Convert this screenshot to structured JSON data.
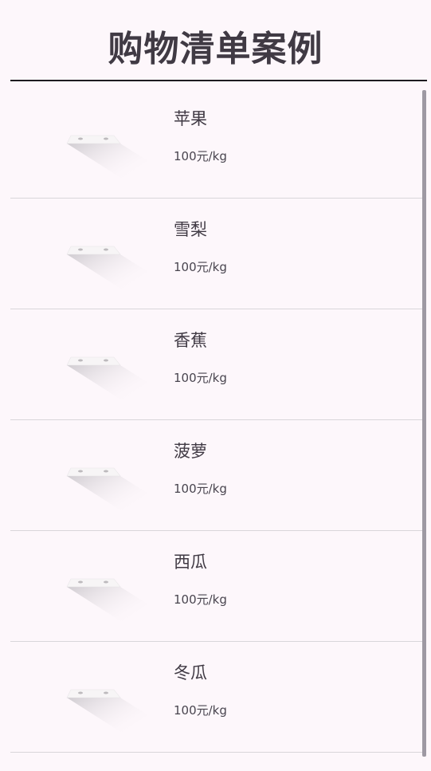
{
  "header": {
    "title": "购物清单案例"
  },
  "items": [
    {
      "name": "苹果",
      "price": "100元/kg",
      "image_icon": "placeholder-image-icon"
    },
    {
      "name": "雪梨",
      "price": "100元/kg",
      "image_icon": "placeholder-image-icon"
    },
    {
      "name": "香蕉",
      "price": "100元/kg",
      "image_icon": "placeholder-image-icon"
    },
    {
      "name": "菠萝",
      "price": "100元/kg",
      "image_icon": "placeholder-image-icon"
    },
    {
      "name": "西瓜",
      "price": "100元/kg",
      "image_icon": "placeholder-image-icon"
    },
    {
      "name": "冬瓜",
      "price": "100元/kg",
      "image_icon": "placeholder-image-icon"
    }
  ],
  "colors": {
    "background": "#FDF7FB",
    "title_text": "#403A44",
    "divider": "#D9D6DA",
    "scrollbar": "#9E99A3"
  }
}
